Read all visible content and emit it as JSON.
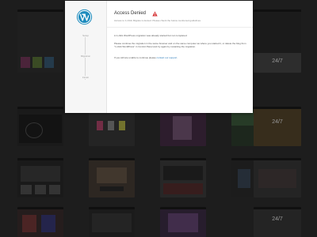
{
  "modal": {
    "title": "Access Denied",
    "subtitle": "Access to 1-Click Migrate is denied. Please check the below mentioned guidelines.",
    "steps": [
      "Setup",
      "Migration",
      "Finish"
    ],
    "paragraphs": {
      "p1": "A 1-click WordPress migration was already started but not completed.",
      "p2": "Please continue the migration in the same browser and on the same computer as where you started it, or delete the blog from \"1-click WordPress\" in Control Panel and try again by restarting the migration.",
      "p3_prefix": "If you still are unable to continue please",
      "p3_link": "contact our support",
      "p3_suffix": "."
    },
    "accent_color": "#1e8cbe",
    "warning_color": "#d63638",
    "logo_icon": "wordpress-logo-icon",
    "warning_icon": "warning-icon"
  },
  "background": {
    "thumbnails": [
      {
        "label": "",
        "color": "#333333"
      },
      {
        "label": "",
        "color": "#2c2c2c"
      },
      {
        "label": "24/7",
        "color": "#3a3a3a"
      },
      {
        "label": "",
        "color": "#4a2f4a"
      },
      {
        "label": "",
        "color": "#2f3f2f"
      },
      {
        "label": "24/7",
        "color": "#5a4a2e"
      },
      {
        "label": "",
        "color": "#2a2a2a"
      },
      {
        "label": "",
        "color": "#4a3f38"
      },
      {
        "label": "",
        "color": "#3f3f3f"
      },
      {
        "label": "",
        "color": "#2e2e2e"
      },
      {
        "label": "",
        "color": "#3a3a3a"
      },
      {
        "label": "",
        "color": "#3c3030"
      },
      {
        "label": "",
        "color": "#2c2c2c"
      },
      {
        "label": "",
        "color": "#3f2f4a"
      },
      {
        "label": "24/7",
        "color": "#3a3a3a"
      }
    ]
  }
}
